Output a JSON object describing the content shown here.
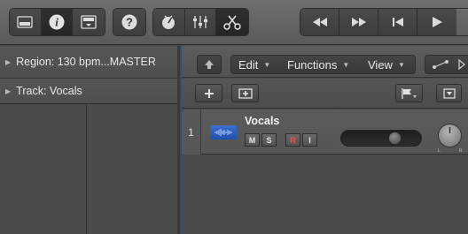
{
  "control_bar": {
    "view_buttons": [
      {
        "icon": "library-icon"
      },
      {
        "icon": "inspector-info-icon",
        "active": true
      },
      {
        "icon": "toolbar-panel-icon"
      }
    ],
    "help_icon": "help-question-icon",
    "mode_buttons": [
      {
        "icon": "metronome-icon"
      },
      {
        "icon": "mixer-sliders-icon"
      },
      {
        "icon": "editors-scissors-icon",
        "active": true
      }
    ],
    "transport": [
      {
        "icon": "rewind-icon"
      },
      {
        "icon": "fast-forward-icon"
      },
      {
        "icon": "go-to-start-icon"
      },
      {
        "icon": "play-icon"
      }
    ]
  },
  "inspector": {
    "region_label": "Region: 130 bpm...MASTER",
    "track_label": "Track:  Vocals"
  },
  "tracks_toolbar": {
    "back_icon": "up-arrow-icon",
    "menus": [
      "Edit",
      "Functions",
      "View"
    ],
    "automation_icon": "automation-curve-icon"
  },
  "tracks_header": {
    "add_icon": "plus-icon",
    "duplicate_icon": "duplicate-track-icon",
    "flag_icon": "flag-icon",
    "dropdown_icon": "dropdown-triangle-icon"
  },
  "track": {
    "number": "1",
    "name": "Vocals",
    "buttons": [
      "M",
      "S",
      "R",
      "I"
    ],
    "pan_left": "L",
    "pan_right": "R",
    "volume_level": 0.72
  },
  "colors": {
    "record": "#e55454",
    "audio_icon": "#2f63c6",
    "selection_edge": "#324a78"
  }
}
